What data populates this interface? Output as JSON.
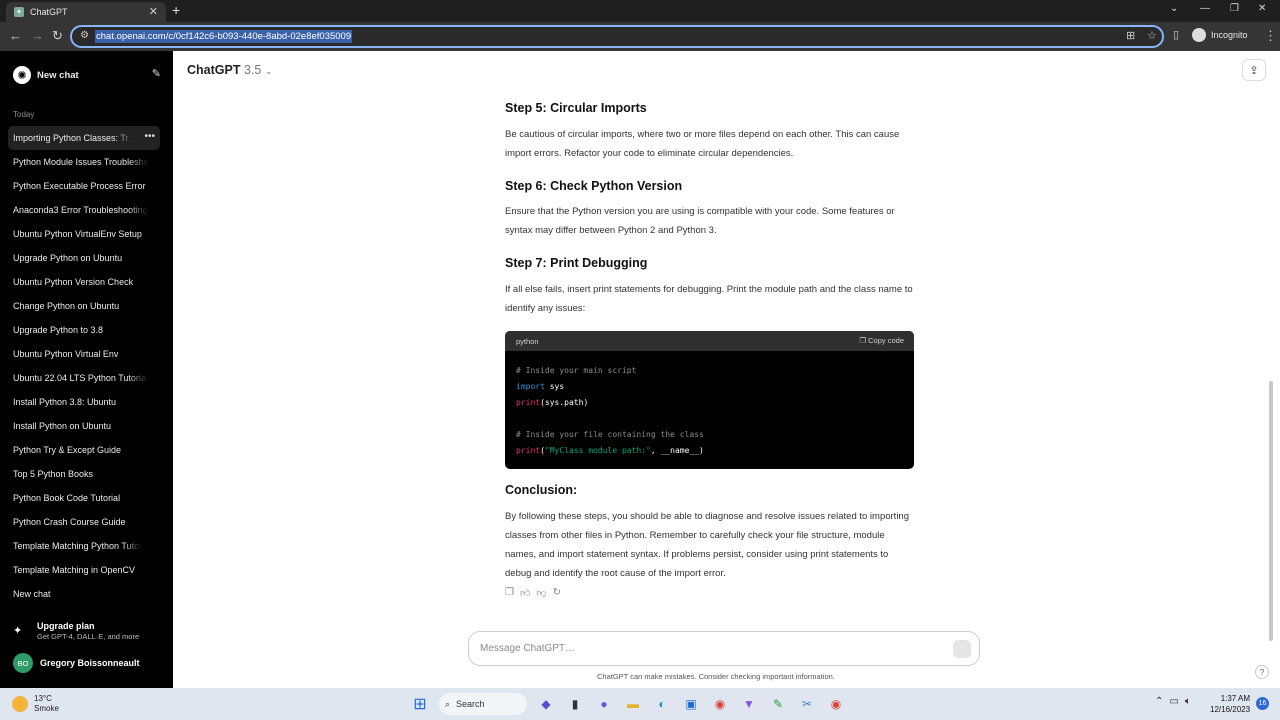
{
  "browser": {
    "tab_title": "ChatGPT",
    "url": "chat.openai.com/c/0cf142c6-b093-440e-8abd-02e8ef035009",
    "incognito_label": "Incognito"
  },
  "sidebar": {
    "new_chat_label": "New chat",
    "section_today": "Today",
    "items": [
      {
        "label": "Importing Python Classes: Tr"
      },
      {
        "label": "Python Module Issues Troublesho"
      },
      {
        "label": "Python Executable Process Error"
      },
      {
        "label": "Anaconda3 Error Troubleshooting"
      },
      {
        "label": "Ubuntu Python VirtualEnv Setup"
      },
      {
        "label": "Upgrade Python on Ubuntu"
      },
      {
        "label": "Ubuntu Python Version Check"
      },
      {
        "label": "Change Python on Ubuntu"
      },
      {
        "label": "Upgrade Python to 3.8"
      },
      {
        "label": "Ubuntu Python Virtual Env"
      },
      {
        "label": "Ubuntu 22.04 LTS Python Tutorial"
      },
      {
        "label": "Install Python 3.8: Ubuntu"
      },
      {
        "label": "Install Python on Ubuntu"
      },
      {
        "label": "Python Try & Except Guide"
      },
      {
        "label": "Top 5 Python Books"
      },
      {
        "label": "Python Book Code Tutorial"
      },
      {
        "label": "Python Crash Course Guide"
      },
      {
        "label": "Template Matching Python Tutor"
      },
      {
        "label": "Template Matching in OpenCV"
      },
      {
        "label": "New chat"
      }
    ],
    "upgrade_title": "Upgrade plan",
    "upgrade_sub": "Get GPT-4, DALL·E, and more",
    "user_initials": "BO",
    "user_name": "Gregory Boissonneault"
  },
  "header": {
    "model_name": "ChatGPT",
    "model_version": "3.5"
  },
  "content": {
    "step5_title": "Step 5: Circular Imports",
    "step5_text": "Be cautious of circular imports, where two or more files depend on each other. This can cause import errors. Refactor your code to eliminate circular dependencies.",
    "step6_title": "Step 6: Check Python Version",
    "step6_text": "Ensure that the Python version you are using is compatible with your code. Some features or syntax may differ between Python 2 and Python 3.",
    "step7_title": "Step 7: Print Debugging",
    "step7_text": "If all else fails, insert print statements for debugging. Print the module path and the class name to identify any issues:",
    "code_lang": "python",
    "copy_label": "Copy code",
    "code": {
      "line1": "# Inside your main script",
      "line2_kw": "import",
      "line2_rest": " sys",
      "line3_fn": "print",
      "line3_rest": "(sys.path)",
      "line5": "# Inside your file containing the class",
      "line6_fn": "print",
      "line6_open": "(",
      "line6_str": "\"MyClass module path:\"",
      "line6_rest": ", __name__)"
    },
    "conclusion_title": "Conclusion:",
    "conclusion_text": "By following these steps, you should be able to diagnose and resolve issues related to importing classes from other files in Python. Remember to carefully check your file structure, module names, and import statement syntax. If problems persist, consider using print statements to debug and identify the root cause of the import error."
  },
  "composer": {
    "placeholder": "Message ChatGPT…",
    "disclaimer": "ChatGPT can make mistakes. Consider checking important information."
  },
  "taskbar": {
    "temp": "13°C",
    "weather": "Smoke",
    "search_label": "Search",
    "time": "1:37 AM",
    "date": "12/16/2023",
    "notifications": "16"
  }
}
